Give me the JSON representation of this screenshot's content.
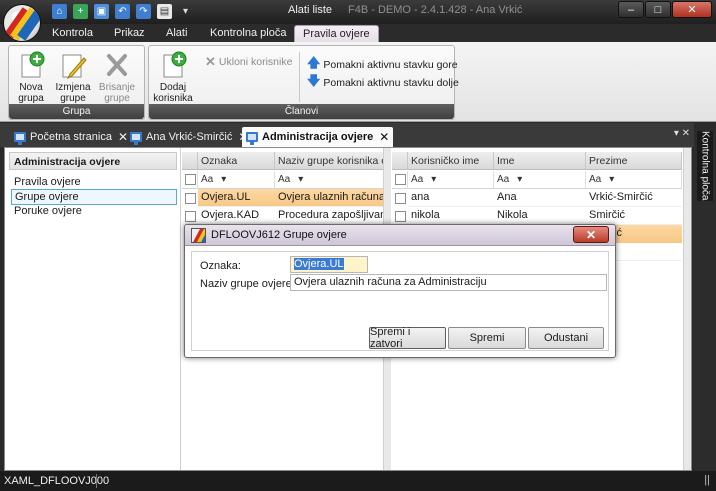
{
  "window": {
    "context_label": "Alati liste",
    "title": "F4B - DEMO - 2.4.1.428 - Ana  Vrkić",
    "minimize": "–",
    "maximize": "□",
    "close": "✕",
    "qat_more": "▾"
  },
  "ribbon_tabs": [
    "Kontrola",
    "Prikaz",
    "Alati",
    "Kontrolna ploča",
    "Pravila ovjere"
  ],
  "ribbon": {
    "group_grupa": {
      "label": "Grupa",
      "nova": "Nova\ngrupa",
      "izmjena": "Izmjena\ngrupe",
      "brisanje": "Brisanje\ngrupe"
    },
    "group_clanovi": {
      "label": "Članovi",
      "dodaj": "Dodaj\nkorisnika",
      "ukloni": "Ukloni korisnike",
      "gore": "Pomakni aktivnu stavku gore",
      "dolje": "Pomakni aktivnu stavku dolje"
    }
  },
  "doc_tabs": [
    {
      "label": "Početna stranica"
    },
    {
      "label": "Ana Vrkić-Smirčić"
    },
    {
      "label": "Administracija ovjere"
    }
  ],
  "doc_tab_close": "✕",
  "dock_controls": "▾ ✕",
  "side_panel_label": "Kontrolna ploča",
  "nav": {
    "header": "Administracija ovjere",
    "items": [
      "Pravila ovjere",
      "Grupe ovjere",
      "Poruke ovjere"
    ]
  },
  "filter_text": "Aa",
  "filter_arrow": "▾",
  "groups_grid": {
    "columns": [
      "Oznaka",
      "Naziv grupe korisnika ov"
    ],
    "rows": [
      [
        "Ovjera.UL",
        "Ovjera ulaznih računa za"
      ],
      [
        "Ovjera.KAD",
        "Procedura zapošljivanja"
      ]
    ]
  },
  "members_grid": {
    "columns": [
      "Korisničko ime",
      "Ime",
      "Prezime"
    ],
    "rows": [
      [
        "ana",
        "Ana",
        "Vrkić-Smirčić"
      ],
      [
        "nikola",
        "Nikola",
        "Smirčić"
      ],
      [
        "",
        "",
        "a-Jurić"
      ],
      [
        "",
        "",
        "an"
      ]
    ]
  },
  "dialog": {
    "title": "DFLOOVJ612  Grupe ovjere",
    "close": "✕",
    "oznaka_label": "Oznaka:",
    "oznaka_value": "Ovjera.UL",
    "naziv_label": "Naziv grupe ovjere:",
    "naziv_value": "Ovjera ulaznih računa za Administraciju",
    "btn_spremi_zatvori": "Spremi i zatvori",
    "btn_spremi": "Spremi",
    "btn_odustani": "Odustani"
  },
  "status": {
    "text": "XAML_DFLOOVJ000",
    "grip": "||"
  },
  "colors": {
    "accent_tab": "#e7dfe7",
    "row_highlight": "#f8c785",
    "selection_border": "#59a8d8",
    "close_red": "#b83b29"
  }
}
